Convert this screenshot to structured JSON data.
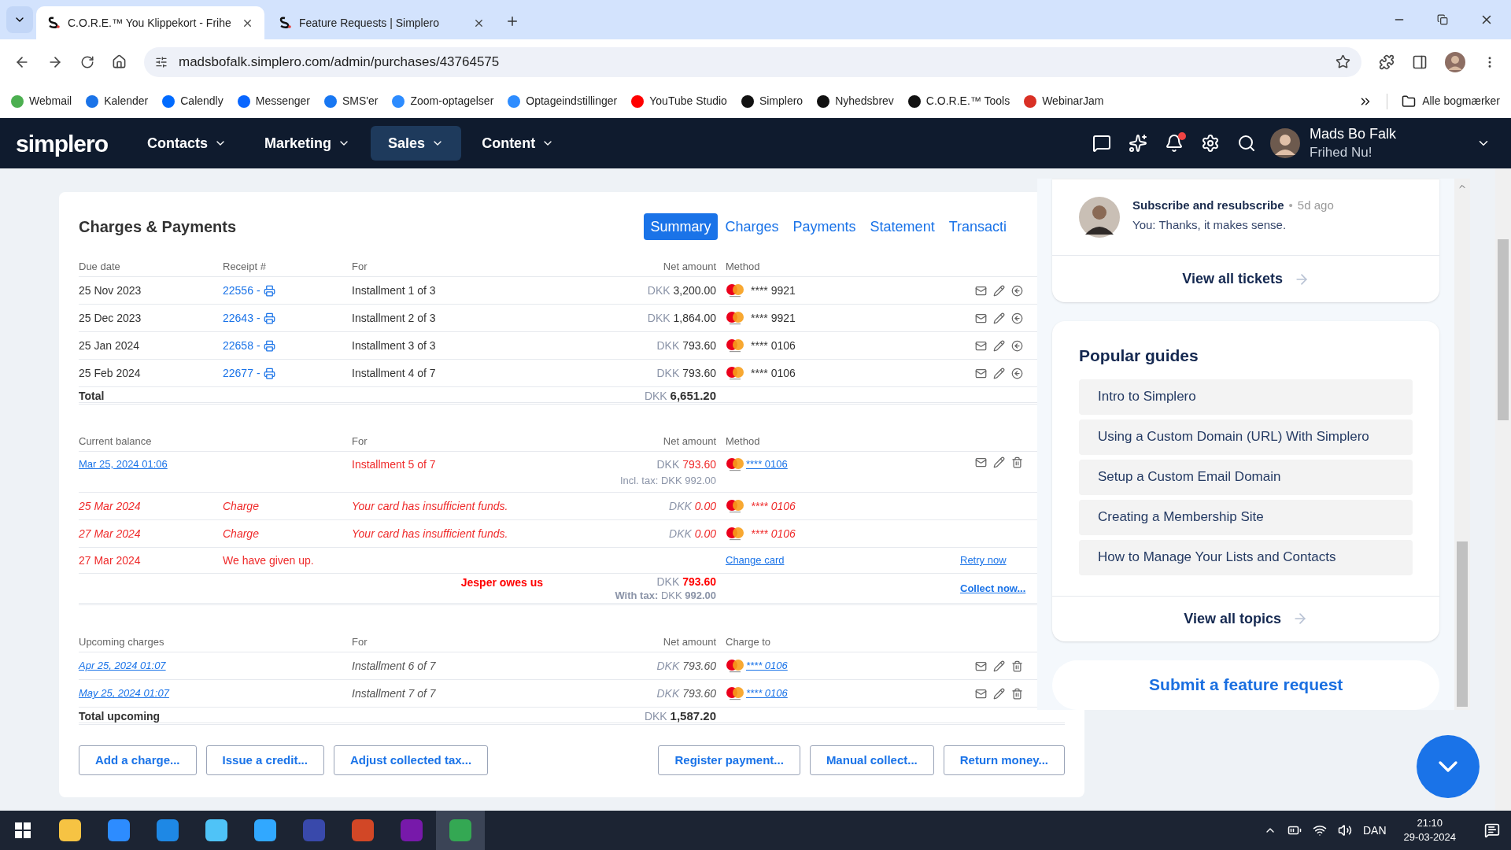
{
  "browser": {
    "tabs": [
      {
        "title": "C.O.R.E.™ You Klippekort - Frihe",
        "selected": true
      },
      {
        "title": "Feature Requests | Simplero",
        "selected": false
      }
    ],
    "url": "madsbofalk.simplero.com/admin/purchases/43764575",
    "bookmarks": [
      {
        "label": "Webmail",
        "color": "#4caf50"
      },
      {
        "label": "Kalender",
        "color": "#1a73e8"
      },
      {
        "label": "Calendly",
        "color": "#006bff"
      },
      {
        "label": "Messenger",
        "color": "#0866ff"
      },
      {
        "label": "SMS'er",
        "color": "#1877f2"
      },
      {
        "label": "Zoom-optagelser",
        "color": "#2d8cff"
      },
      {
        "label": "Optageindstillinger",
        "color": "#2d8cff"
      },
      {
        "label": "YouTube Studio",
        "color": "#ff0000"
      },
      {
        "label": "Simplero",
        "color": "#111111"
      },
      {
        "label": "Nyhedsbrev",
        "color": "#111111"
      },
      {
        "label": "C.O.R.E.™ Tools",
        "color": "#111111"
      },
      {
        "label": "WebinarJam",
        "color": "#d93025"
      }
    ],
    "all_bookmarks": "Alle bogmærker"
  },
  "app": {
    "logo": "simplero",
    "menu": [
      {
        "label": "Contacts",
        "selected": false
      },
      {
        "label": "Marketing",
        "selected": false
      },
      {
        "label": "Sales",
        "selected": true
      },
      {
        "label": "Content",
        "selected": false
      }
    ],
    "notifications_unread": true,
    "user": {
      "name": "Mads Bo Falk",
      "subtitle": "Frihed Nu!"
    }
  },
  "charges": {
    "title": "Charges & Payments",
    "tabs": [
      {
        "label": "Summary",
        "selected": true
      },
      {
        "label": "Charges",
        "selected": false
      },
      {
        "label": "Payments",
        "selected": false
      },
      {
        "label": "Statement",
        "selected": false
      },
      {
        "label": "Transacti",
        "selected": false
      }
    ],
    "paid": {
      "columns": [
        "Due date",
        "Receipt #",
        "For",
        "Net amount",
        "Method"
      ],
      "receipt_separator": "-",
      "rows": [
        {
          "due": "25 Nov 2023",
          "receipt": "22556",
          "for": "Installment 1 of 3",
          "currency": "DKK",
          "amount": "3,200.00",
          "card": "**** 9921"
        },
        {
          "due": "25 Dec 2023",
          "receipt": "22643",
          "for": "Installment 2 of 3",
          "currency": "DKK",
          "amount": "1,864.00",
          "card": "**** 9921"
        },
        {
          "due": "25 Jan 2024",
          "receipt": "22658",
          "for": "Installment 3 of 3",
          "currency": "DKK",
          "amount": "793.60",
          "card": "**** 0106"
        },
        {
          "due": "25 Feb 2024",
          "receipt": "22677",
          "for": "Installment 4 of 7",
          "currency": "DKK",
          "amount": "793.60",
          "card": "**** 0106"
        }
      ],
      "total": {
        "label": "Total",
        "currency": "DKK",
        "amount": "6,651.20"
      }
    },
    "balance": {
      "columns": [
        "Current balance",
        "For",
        "Net amount",
        "Method"
      ],
      "rows": [
        {
          "kind": "scheduled",
          "date": "Mar 25, 2024 01:06",
          "for": "Installment 5 of 7",
          "currency": "DKK",
          "amount": "793.60",
          "tax": "Incl. tax: DKK 992.00",
          "card": "**** 0106"
        },
        {
          "kind": "failed",
          "date": "25 Mar 2024",
          "type": "Charge",
          "message": "Your card has insufficient funds.",
          "currency": "DKK",
          "amount": "0.00",
          "card": "**** 0106"
        },
        {
          "kind": "failed",
          "date": "27 Mar 2024",
          "type": "Charge",
          "message": "Your card has insufficient funds.",
          "currency": "DKK",
          "amount": "0.00",
          "card": "**** 0106"
        },
        {
          "kind": "given_up",
          "date": "27 Mar 2024",
          "note": "We have given up.",
          "link": "Change card",
          "action": "Retry now"
        },
        {
          "kind": "owes",
          "label": "Jesper owes us",
          "currency": "DKK",
          "amount": "793.60",
          "tax_label": "With tax:",
          "tax_currency": "DKK",
          "tax_amount": "992.00",
          "action": "Collect now..."
        }
      ]
    },
    "upcoming": {
      "columns": [
        "Upcoming charges",
        "For",
        "Net amount",
        "Charge to"
      ],
      "rows": [
        {
          "date": "Apr 25, 2024 01:07",
          "for": "Installment 6 of 7",
          "currency": "DKK",
          "amount": "793.60",
          "card": "**** 0106"
        },
        {
          "date": "May 25, 2024 01:07",
          "for": "Installment 7 of 7",
          "currency": "DKK",
          "amount": "793.60",
          "card": "**** 0106"
        }
      ],
      "total": {
        "label": "Total upcoming",
        "currency": "DKK",
        "amount": "1,587.20"
      }
    },
    "buttons_left": [
      "Add a charge...",
      "Issue a credit...",
      "Adjust collected tax..."
    ],
    "buttons_right": [
      "Register payment...",
      "Manual collect...",
      "Return money..."
    ]
  },
  "help": {
    "ticket": {
      "title": "Subscribe and resubscribe",
      "separator": "•",
      "time": "5d ago",
      "message": "You: Thanks, it makes sense."
    },
    "view_tickets": "View all tickets",
    "guides_title": "Popular guides",
    "guides": [
      "Intro to Simplero",
      "Using a Custom Domain (URL) With Simplero",
      "Setup a Custom Email Domain",
      "Creating a Membership Site",
      "How to Manage Your Lists and Contacts"
    ],
    "view_topics": "View all topics",
    "feature_request": "Submit a feature request"
  },
  "taskbar": {
    "apps": [
      {
        "color": "#f6c343",
        "selected": false
      },
      {
        "color": "#2d8cff",
        "selected": false
      },
      {
        "color": "#1e88e5",
        "selected": false
      },
      {
        "color": "#4fc3f7",
        "selected": false
      },
      {
        "color": "#31a8ff",
        "selected": false
      },
      {
        "color": "#3949ab",
        "selected": false
      },
      {
        "color": "#d24726",
        "selected": false
      },
      {
        "color": "#7719aa",
        "selected": false
      },
      {
        "color": "#34a853",
        "selected": true
      }
    ],
    "language": "DAN",
    "time": "21:10",
    "date": "29-03-2024"
  }
}
